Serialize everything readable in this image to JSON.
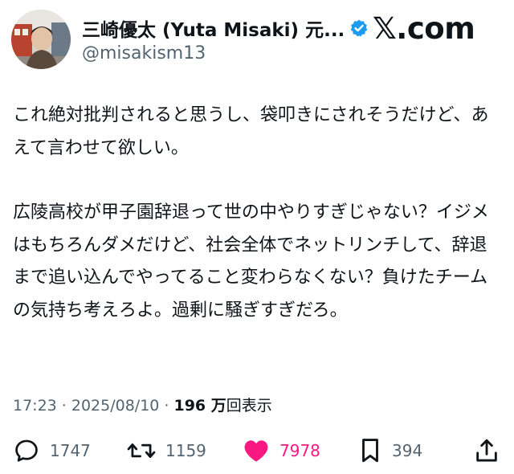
{
  "author": {
    "display_name": "三崎優太 (Yuta Misaki) 元...",
    "handle": "@misakism13",
    "verified": true
  },
  "brand": {
    "label": "𝕏.com"
  },
  "post": {
    "paragraphs": [
      "これ絶対批判されると思うし、袋叩きにされそうだけど、あえて言わせて欲しい。",
      "広陵高校が甲子園辞退って世の中やりすぎじゃない？イジメはもちろんダメだけど、社会全体でネットリンチして、辞退まで追い込んでやってること変わらなくない？負けたチームの気持ち考えろよ。過剰に騒ぎすぎだろ。"
    ]
  },
  "meta": {
    "timestamp": "17:23 · 2025/08/10 ·",
    "views_count": "196 万",
    "views_label": "回表示"
  },
  "actions": {
    "replies": "1747",
    "reposts": "1159",
    "likes": "7978",
    "bookmarks": "394"
  },
  "colors": {
    "text": "#0f1419",
    "secondary": "#536471",
    "verified": "#1d9bf0",
    "like": "#f91880"
  }
}
